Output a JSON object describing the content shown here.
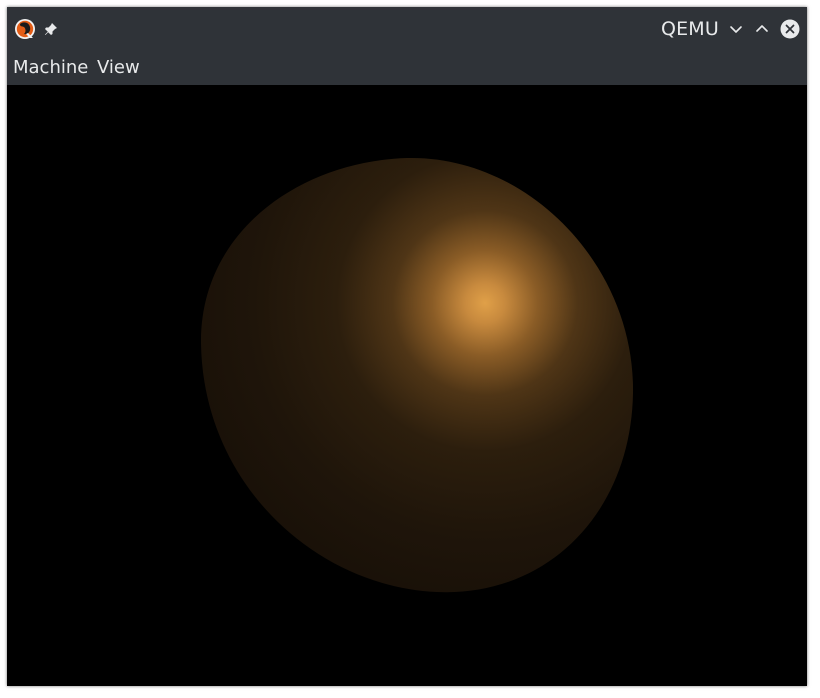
{
  "window": {
    "title": "QEMU",
    "menu": [
      {
        "label": "Machine"
      },
      {
        "label": "View"
      }
    ]
  },
  "icons": {
    "app": "qemu-icon",
    "pin": "pin-icon",
    "minimize": "chevron-down-icon",
    "maximize": "chevron-up-icon",
    "close": "close-icon"
  },
  "colors": {
    "titlebar_bg": "#2f3338",
    "text": "#e8eaeb",
    "display_bg": "#000000",
    "sphere_highlight": "#e0a048",
    "sphere_base": "#1f150a"
  }
}
